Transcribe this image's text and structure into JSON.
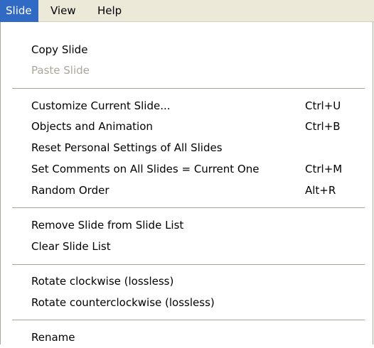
{
  "menubar": {
    "menus": [
      {
        "label": "Slide"
      },
      {
        "label": "View"
      },
      {
        "label": "Help"
      }
    ]
  },
  "menu": {
    "items": [
      {
        "label": "Copy Slide",
        "shortcut": ""
      },
      {
        "label": "Paste Slide",
        "shortcut": "",
        "disabled": true
      },
      {
        "label": "Customize Current Slide...",
        "shortcut": "Ctrl+U"
      },
      {
        "label": "Objects and Animation",
        "shortcut": "Ctrl+B"
      },
      {
        "label": "Reset Personal Settings of All Slides",
        "shortcut": ""
      },
      {
        "label": "Set Comments on All Slides = Current One",
        "shortcut": "Ctrl+M"
      },
      {
        "label": "Random Order",
        "shortcut": "Alt+R"
      },
      {
        "label": "Remove Slide from Slide List",
        "shortcut": ""
      },
      {
        "label": "Clear Slide List",
        "shortcut": ""
      },
      {
        "label": "Rotate clockwise (lossless)",
        "shortcut": ""
      },
      {
        "label": "Rotate counterclockwise (lossless)",
        "shortcut": ""
      },
      {
        "label": "Rename",
        "shortcut": ""
      }
    ]
  },
  "colors": {
    "menubar_bg": "#ece9d8",
    "highlight": "#316ac5",
    "disabled_text": "#aca899"
  }
}
